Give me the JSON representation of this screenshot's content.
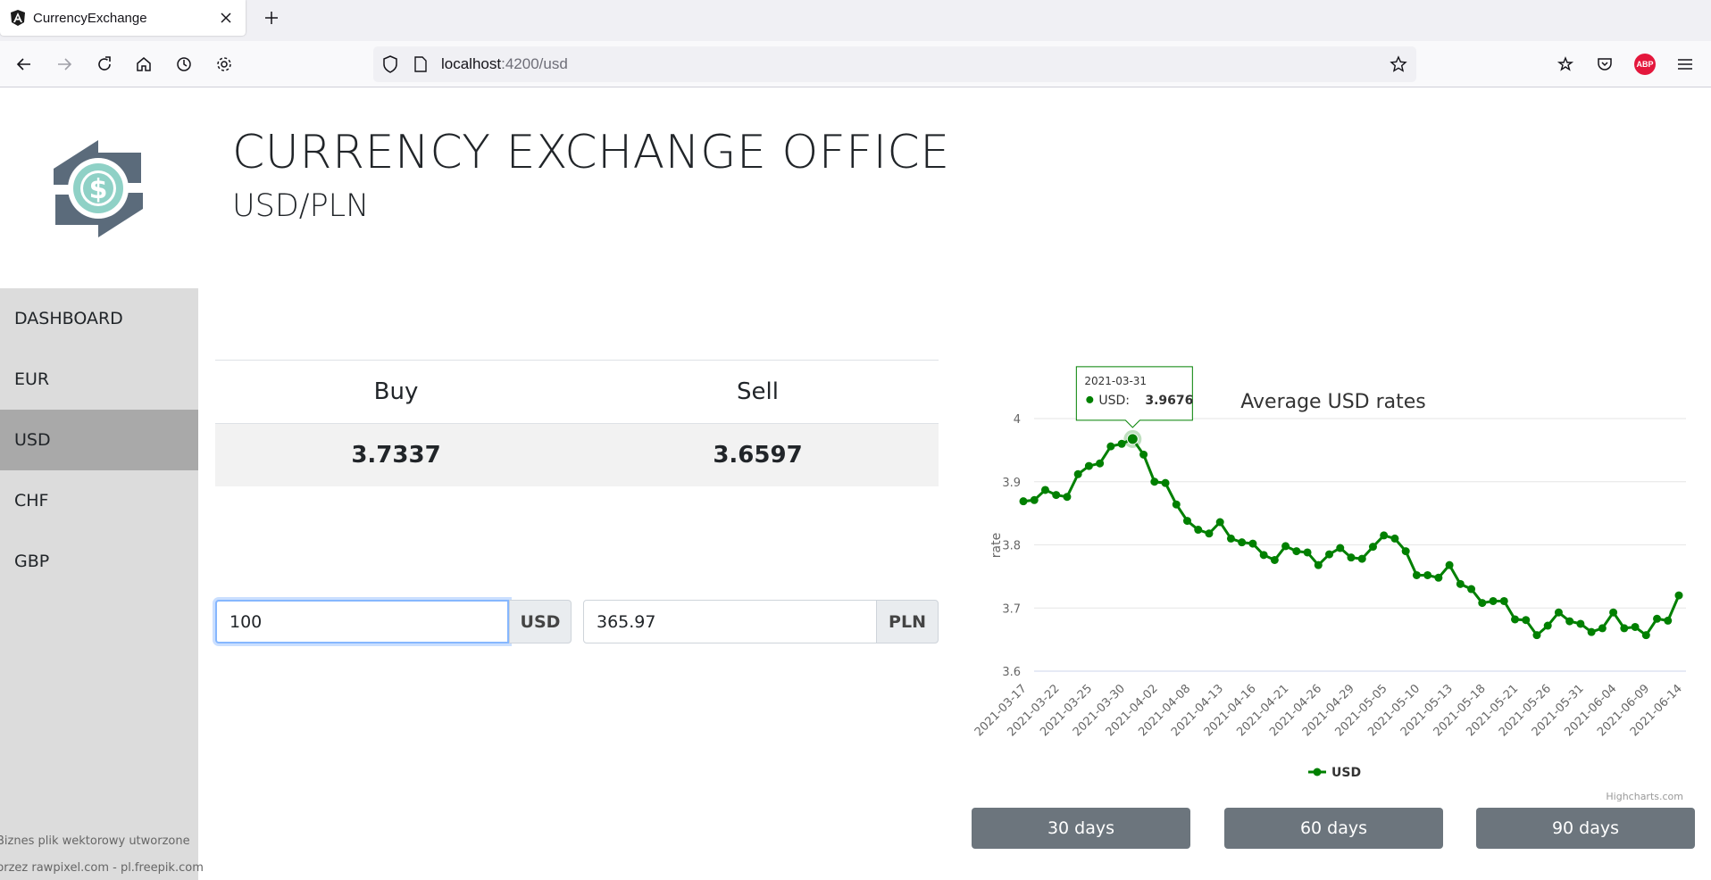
{
  "browser": {
    "tab_title": "CurrencyExchange",
    "url_host": "localhost",
    "url_path": ":4200/usd"
  },
  "header": {
    "title": "CURRENCY EXCHANGE OFFICE",
    "pair": "USD/PLN"
  },
  "sidebar": {
    "items": [
      {
        "label": "DASHBOARD"
      },
      {
        "label": "EUR"
      },
      {
        "label": "USD"
      },
      {
        "label": "CHF"
      },
      {
        "label": "GBP"
      }
    ],
    "active": "USD",
    "credits": [
      "Biznes plik wektorowy utworzone",
      "przez rawpixel.com - pl.freepik.com"
    ]
  },
  "rates": {
    "buy_label": "Buy",
    "sell_label": "Sell",
    "buy_value": "3.7337",
    "sell_value": "3.6597"
  },
  "converter": {
    "amount": "100",
    "from_currency": "USD",
    "result": "365.97",
    "to_currency": "PLN"
  },
  "range_buttons": [
    "30 days",
    "60 days",
    "90 days"
  ],
  "colors": {
    "series": "#008000",
    "sidebar_bg": "#dcdcdc",
    "sidebar_active": "#a9a9a9",
    "button": "#6c757d"
  },
  "chart_data": {
    "type": "line",
    "title": "Average USD rates",
    "ylabel": "rate",
    "xlabel": "",
    "ylim": [
      3.6,
      4.0
    ],
    "yticks": [
      "3.6",
      "3.7",
      "3.8",
      "3.9",
      "4"
    ],
    "legend_position": "bottom",
    "credits": "Highcharts.com",
    "xtick_labels": [
      "2021-03-17",
      "2021-03-22",
      "2021-03-25",
      "2021-03-30",
      "2021-04-02",
      "2021-04-08",
      "2021-04-13",
      "2021-04-16",
      "2021-04-21",
      "2021-04-26",
      "2021-04-29",
      "2021-05-05",
      "2021-05-10",
      "2021-05-13",
      "2021-05-18",
      "2021-05-21",
      "2021-05-26",
      "2021-05-31",
      "2021-06-04",
      "2021-06-09",
      "2021-06-14"
    ],
    "tooltip": {
      "date": "2021-03-31",
      "series": "USD",
      "value": "3.9676"
    },
    "series": [
      {
        "name": "USD",
        "values": [
          3.869,
          3.871,
          3.887,
          3.879,
          3.876,
          3.912,
          3.925,
          3.929,
          3.956,
          3.96,
          3.9676,
          3.943,
          3.9,
          3.898,
          3.864,
          3.838,
          3.824,
          3.818,
          3.836,
          3.81,
          3.804,
          3.802,
          3.784,
          3.776,
          3.798,
          3.79,
          3.788,
          3.768,
          3.785,
          3.795,
          3.78,
          3.778,
          3.797,
          3.815,
          3.81,
          3.79,
          3.752,
          3.752,
          3.748,
          3.768,
          3.738,
          3.73,
          3.708,
          3.711,
          3.711,
          3.682,
          3.681,
          3.657,
          3.672,
          3.693,
          3.679,
          3.675,
          3.662,
          3.668,
          3.693,
          3.668,
          3.67,
          3.657,
          3.683,
          3.68,
          3.72
        ]
      }
    ]
  }
}
